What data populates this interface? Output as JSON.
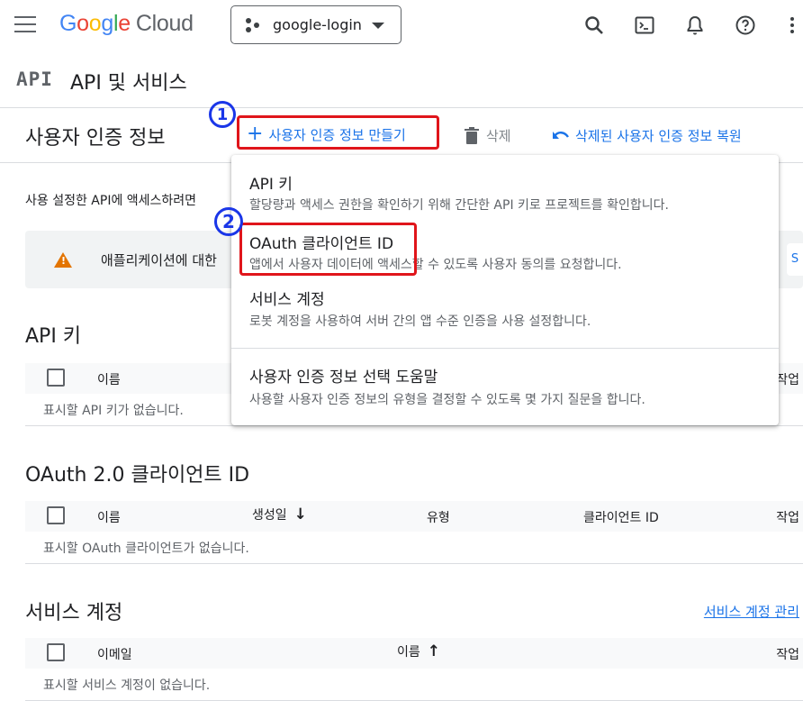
{
  "topbar": {
    "logo_google": [
      "G",
      "o",
      "o",
      "g",
      "l",
      "e"
    ],
    "logo_cloud": "Cloud",
    "project_name": "google-login",
    "icons": [
      "search-icon",
      "terminal-icon",
      "bell-icon",
      "help-icon",
      "more-vert-icon"
    ]
  },
  "api_bar": {
    "badge": "API",
    "title": "API 및 서비스"
  },
  "credentials": {
    "title": "사용자 인증 정보",
    "create_label": "사용자 인증 정보 만들기",
    "delete_label": "삭제",
    "restore_label": "삭제된 사용자 인증 정보 복원",
    "description": "사용 설정한 API에 액세스하려면",
    "warning_text": "애플리케이션에 대한",
    "warning_button": "S"
  },
  "annotations": {
    "step1": "1",
    "step2": "2"
  },
  "menu": {
    "items": [
      {
        "title": "API 키",
        "subtitle": "할당량과 액세스 권한을 확인하기 위해 간단한 API 키로 프로젝트를 확인합니다."
      },
      {
        "title": "OAuth 클라이언트 ID",
        "subtitle": "앱에서 사용자 데이터에 액세스할 수 있도록 사용자 동의를 요청합니다."
      },
      {
        "title": "서비스 계정",
        "subtitle": "로봇 계정을 사용하여 서버 간의 앱 수준 인증을 사용 설정합니다."
      },
      {
        "title": "사용자 인증 정보 선택 도움말",
        "subtitle": "사용할 사용자 인증 정보의 유형을 결정할 수 있도록 몇 가지 질문을 합니다."
      }
    ]
  },
  "api_keys": {
    "title": "API 키",
    "col_name": "이름",
    "col_action": "작업",
    "empty": "표시할 API 키가 없습니다."
  },
  "oauth": {
    "title": "OAuth 2.0 클라이언트 ID",
    "col_name": "이름",
    "col_created": "생성일",
    "col_type": "유형",
    "col_client_id": "클라이언트 ID",
    "col_action": "작업",
    "sort_arrow": "↓",
    "empty": "표시할 OAuth 클라이언트가 없습니다."
  },
  "service_accounts": {
    "title": "서비스 계정",
    "manage_link": "서비스 계정 관리",
    "col_email": "이메일",
    "col_name": "이름",
    "col_action": "작업",
    "sort_arrow": "↑",
    "empty": "표시할 서비스 계정이 없습니다."
  },
  "colors": {
    "accent": "#1a73e8",
    "annotation_red": "#e0151b",
    "annotation_blue": "#1a36e8",
    "warning": "#e37400"
  }
}
